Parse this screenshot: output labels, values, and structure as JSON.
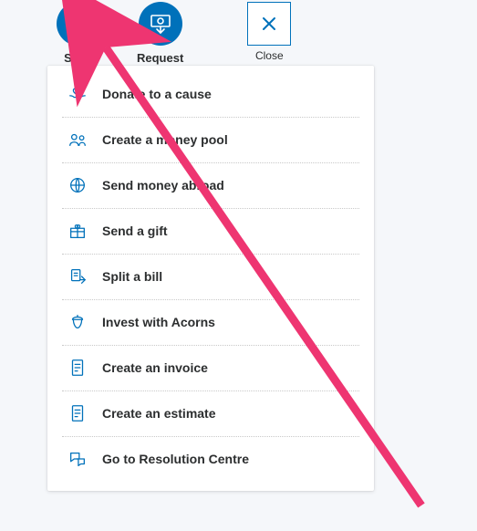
{
  "colors": {
    "accent": "#0071ba",
    "arrow": "#ee3571"
  },
  "top": {
    "send": {
      "label": "Send"
    },
    "request": {
      "label": "Request"
    },
    "close": {
      "label": "Close"
    }
  },
  "menu": {
    "items": [
      {
        "label": "Donate to a cause"
      },
      {
        "label": "Create a money pool"
      },
      {
        "label": "Send money abroad"
      },
      {
        "label": "Send a gift"
      },
      {
        "label": "Split a bill"
      },
      {
        "label": "Invest with Acorns"
      },
      {
        "label": "Create an invoice"
      },
      {
        "label": "Create an estimate"
      },
      {
        "label": "Go to Resolution Centre"
      }
    ]
  }
}
